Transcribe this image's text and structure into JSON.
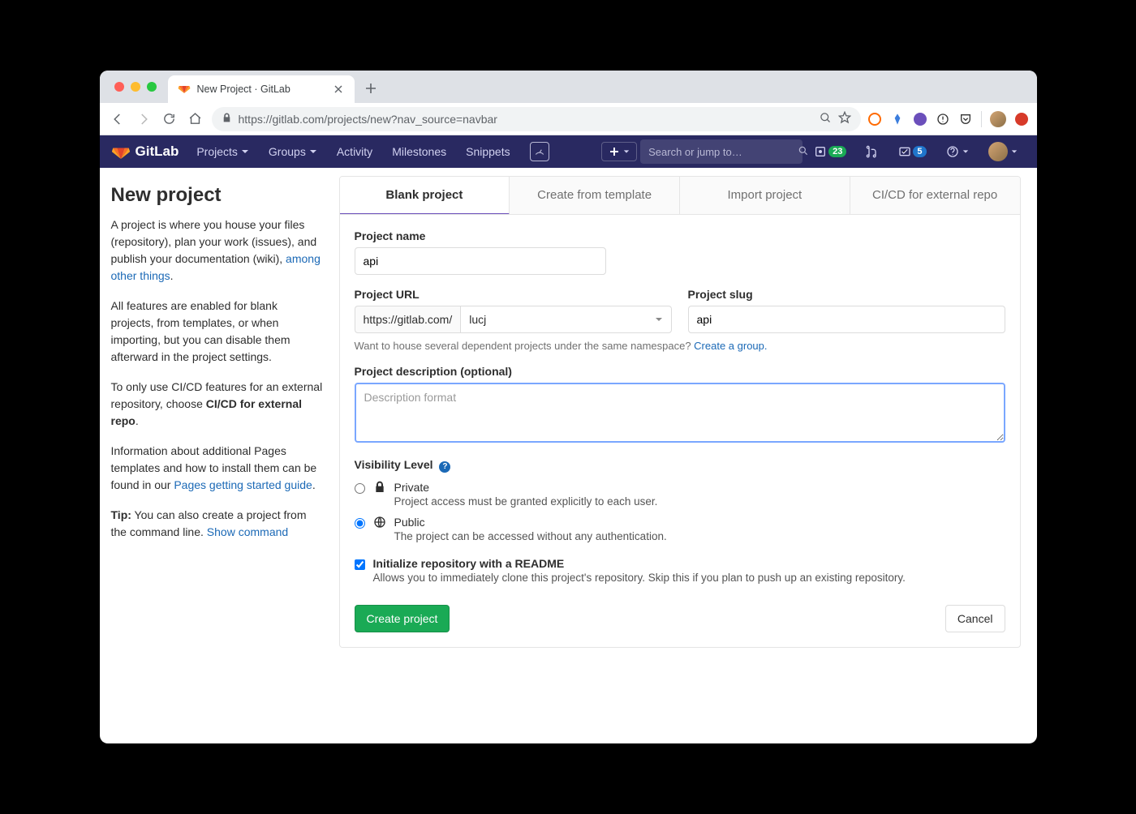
{
  "browser": {
    "tab_title": "New Project · GitLab",
    "url": "https://gitlab.com/projects/new?nav_source=navbar"
  },
  "nav": {
    "brand": "GitLab",
    "items": [
      "Projects",
      "Groups",
      "Activity",
      "Milestones",
      "Snippets"
    ],
    "search_placeholder": "Search or jump to…",
    "issues_count": "23",
    "todos_count": "5"
  },
  "sidebar": {
    "title": "New project",
    "p1a": "A project is where you house your files (repository), plan your work (issues), and publish your documentation (wiki), ",
    "p1_link": "among other things",
    "p1b": ".",
    "p2": "All features are enabled for blank projects, from templates, or when importing, but you can disable them afterward in the project settings.",
    "p3a": "To only use CI/CD features for an external repository, choose ",
    "p3_bold": "CI/CD for external repo",
    "p3b": ".",
    "p4a": "Information about additional Pages templates and how to install them can be found in our ",
    "p4_link": "Pages getting started guide",
    "p4b": ".",
    "p5_bold": "Tip:",
    "p5a": " You can also create a project from the command line. ",
    "p5_link": "Show command"
  },
  "tabs": [
    "Blank project",
    "Create from template",
    "Import project",
    "CI/CD for external repo"
  ],
  "form": {
    "name_label": "Project name",
    "name_value": "api",
    "url_label": "Project URL",
    "url_prefix": "https://gitlab.com/",
    "url_namespace": "lucj",
    "slug_label": "Project slug",
    "slug_value": "api",
    "namespace_hint": "Want to house several dependent projects under the same namespace? ",
    "namespace_link": "Create a group.",
    "desc_label": "Project description (optional)",
    "desc_placeholder": "Description format",
    "visibility_label": "Visibility Level",
    "private_title": "Private",
    "private_desc": "Project access must be granted explicitly to each user.",
    "public_title": "Public",
    "public_desc": "The project can be accessed without any authentication.",
    "readme_title": "Initialize repository with a README",
    "readme_desc": "Allows you to immediately clone this project's repository. Skip this if you plan to push up an existing repository.",
    "create_btn": "Create project",
    "cancel_btn": "Cancel"
  },
  "colors": {
    "navbar": "#292961",
    "accent_purple": "#6b4fbb",
    "link": "#1b69b6",
    "success": "#1aaa55"
  }
}
